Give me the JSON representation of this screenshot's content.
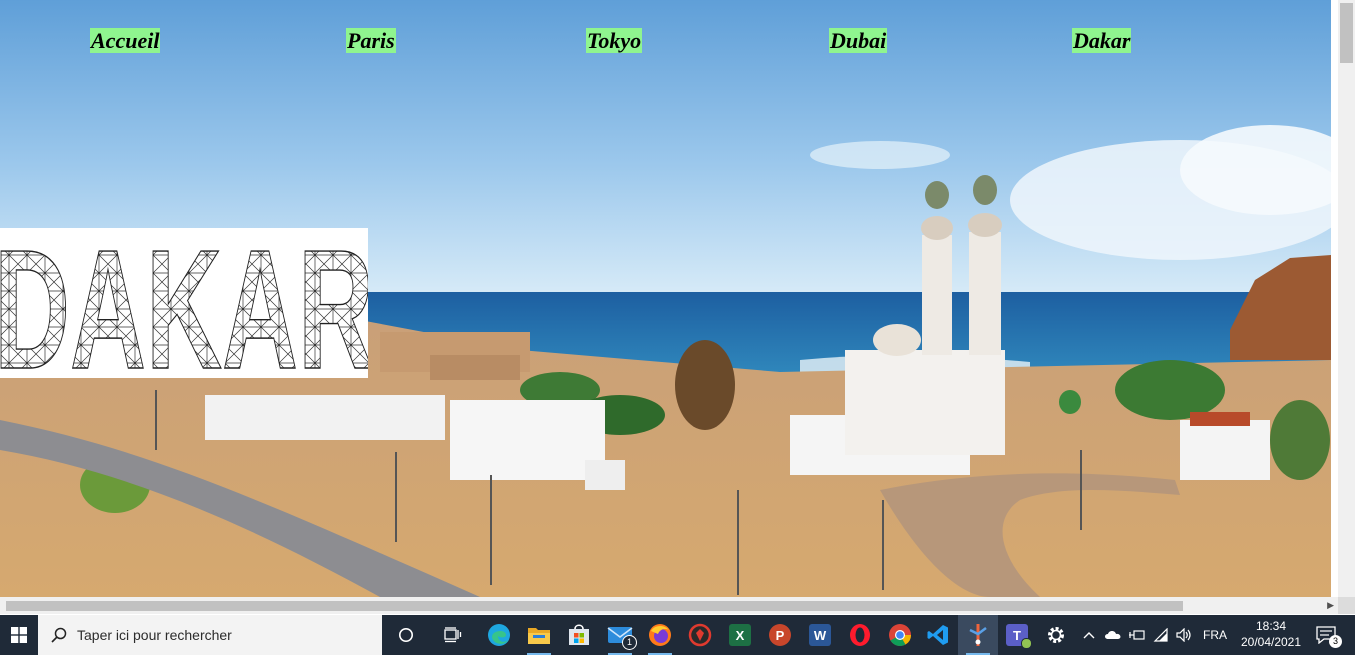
{
  "nav": {
    "items": [
      {
        "label": "Accueil"
      },
      {
        "label": "Paris"
      },
      {
        "label": "Tokyo"
      },
      {
        "label": "Dubai"
      },
      {
        "label": "Dakar"
      }
    ],
    "highlight_color": "#8ff58f"
  },
  "logo": {
    "text": "DAKAR"
  },
  "taskbar": {
    "search_placeholder": "Taper ici pour rechercher",
    "mail_badge": "1",
    "language": "FRA",
    "time": "18:34",
    "date": "20/04/2021",
    "notification_count": "3",
    "icons": [
      "windows-start-icon",
      "task-view-icon",
      "edge-icon",
      "file-explorer-icon",
      "microsoft-store-icon",
      "mail-icon",
      "firefox-icon",
      "app-icon",
      "excel-icon",
      "powerpoint-icon",
      "word-icon",
      "opera-icon",
      "chrome-icon",
      "vscode-icon",
      "git-app-icon",
      "teams-icon",
      "settings-icon"
    ]
  }
}
